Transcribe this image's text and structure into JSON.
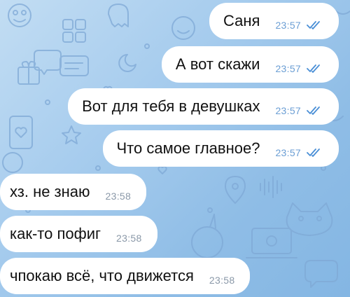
{
  "colors": {
    "outgoing_bubble": "#ffffff",
    "incoming_bubble": "#ffffff",
    "read_checks": "#4a8fd6",
    "wallpaper": "#a8cdee"
  },
  "messages": [
    {
      "direction": "outgoing",
      "text": "Саня",
      "time": "23:57",
      "status_icon": "double-check-icon"
    },
    {
      "direction": "outgoing",
      "text": "А вот скажи",
      "time": "23:57",
      "status_icon": "double-check-icon"
    },
    {
      "direction": "outgoing",
      "text": "Вот для тебя в девушках",
      "time": "23:57",
      "status_icon": "double-check-icon"
    },
    {
      "direction": "outgoing",
      "text": "Что самое главное?",
      "time": "23:57",
      "status_icon": "double-check-icon"
    },
    {
      "direction": "incoming",
      "text": "хз. не знаю",
      "time": "23:58"
    },
    {
      "direction": "incoming",
      "text": "как-то пофиг",
      "time": "23:58"
    },
    {
      "direction": "incoming",
      "text": "чпокаю всё, что движется",
      "time": "23:58"
    }
  ]
}
